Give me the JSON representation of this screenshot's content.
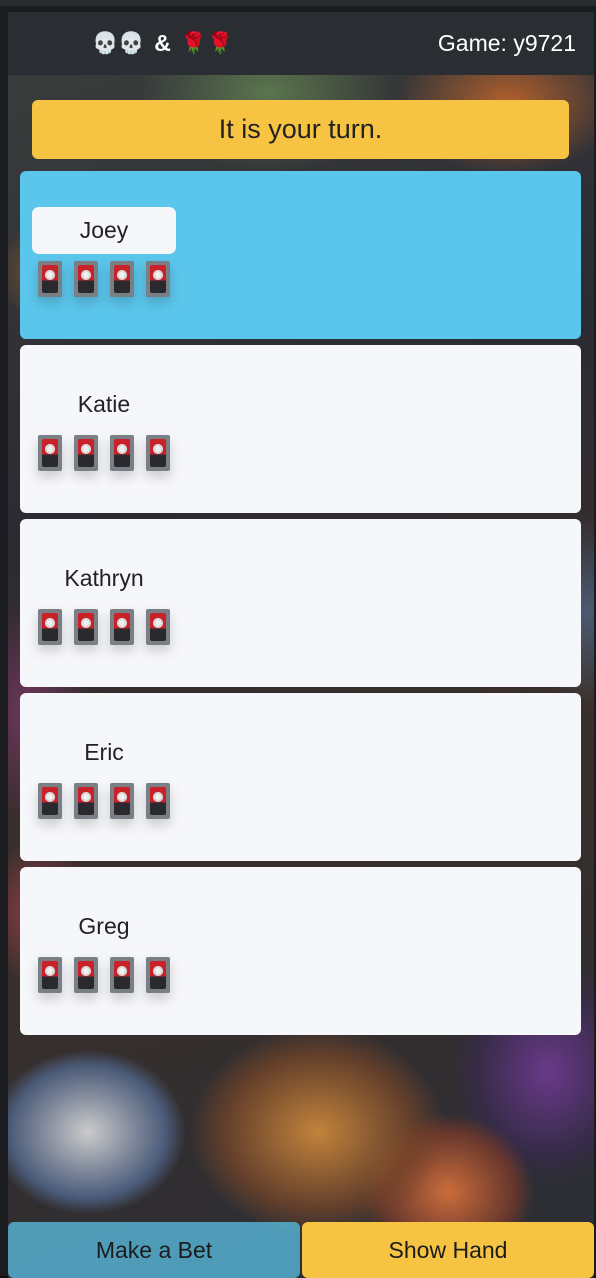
{
  "header": {
    "brand_skulls": "💀💀",
    "brand_amp": "&",
    "brand_roses": "🌹🌹",
    "game_label": "Game: y9721"
  },
  "banner": {
    "text": "It is your turn."
  },
  "players": [
    {
      "name": "Joey",
      "active": true,
      "cards": 4
    },
    {
      "name": "Katie",
      "active": false,
      "cards": 4
    },
    {
      "name": "Kathryn",
      "active": false,
      "cards": 4
    },
    {
      "name": "Eric",
      "active": false,
      "cards": 4
    },
    {
      "name": "Greg",
      "active": false,
      "cards": 4
    }
  ],
  "actions": {
    "bet_label": "Make a Bet",
    "show_label": "Show Hand"
  },
  "colors": {
    "active_card": "#5bc6ec",
    "accent_yellow": "#f6c343",
    "topbar": "#2a2d32",
    "card_bg": "#f6f7fa"
  },
  "icons": {
    "card_back": "card-back-icon"
  }
}
